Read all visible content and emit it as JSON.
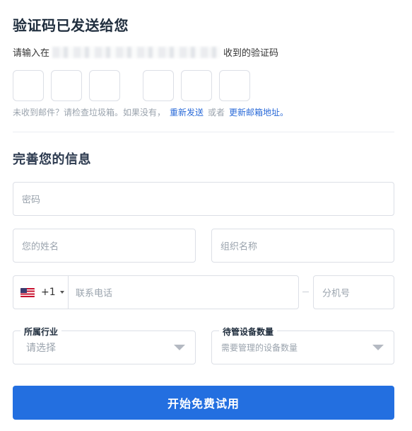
{
  "verification": {
    "title": "验证码已发送给您",
    "prompt_before": "请输入在",
    "prompt_after": "收到的验证码",
    "code_boxes": 6,
    "hint_prefix": "未收到邮件？请检查垃圾箱。如果没有，",
    "resend_link": "重新发送",
    "or_text": "或者",
    "change_email_link": "更新邮箱地址。"
  },
  "profile": {
    "title": "完善您的信息",
    "password_placeholder": "密码",
    "name_placeholder": "您的姓名",
    "org_placeholder": "组织名称",
    "phone": {
      "country_flag": "us-flag-icon",
      "dial_code": "+1",
      "placeholder": "联系电话",
      "extension_placeholder": "分机号"
    },
    "industry": {
      "label": "所属行业",
      "placeholder": "请选择"
    },
    "devices": {
      "label": "待管设备数量",
      "placeholder": "需要管理的设备数量"
    },
    "submit_label": "开始免费试用"
  },
  "colors": {
    "primary": "#236fe0",
    "link": "#2a6ad8",
    "border": "#dcdfe6",
    "placeholder": "#9aa3ad"
  }
}
